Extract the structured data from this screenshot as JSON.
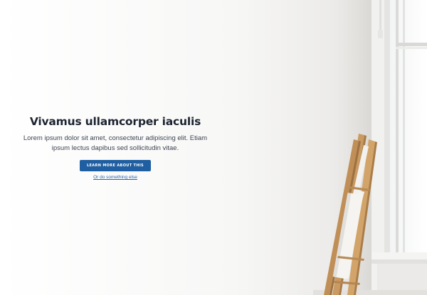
{
  "hero": {
    "title": "Vivamus ullamcorper iaculis",
    "text": "Lorem ipsum dolor sit amet, consectetur adipiscing elit. Etiam ipsum lectus dapibus sed sollicitudin vitae.",
    "cta_label": "Learn more about this",
    "alt_link": "Or do something else"
  },
  "colors": {
    "cta_background": "#1f5ea1",
    "title": "#1d2331",
    "link": "#2b64a8"
  }
}
